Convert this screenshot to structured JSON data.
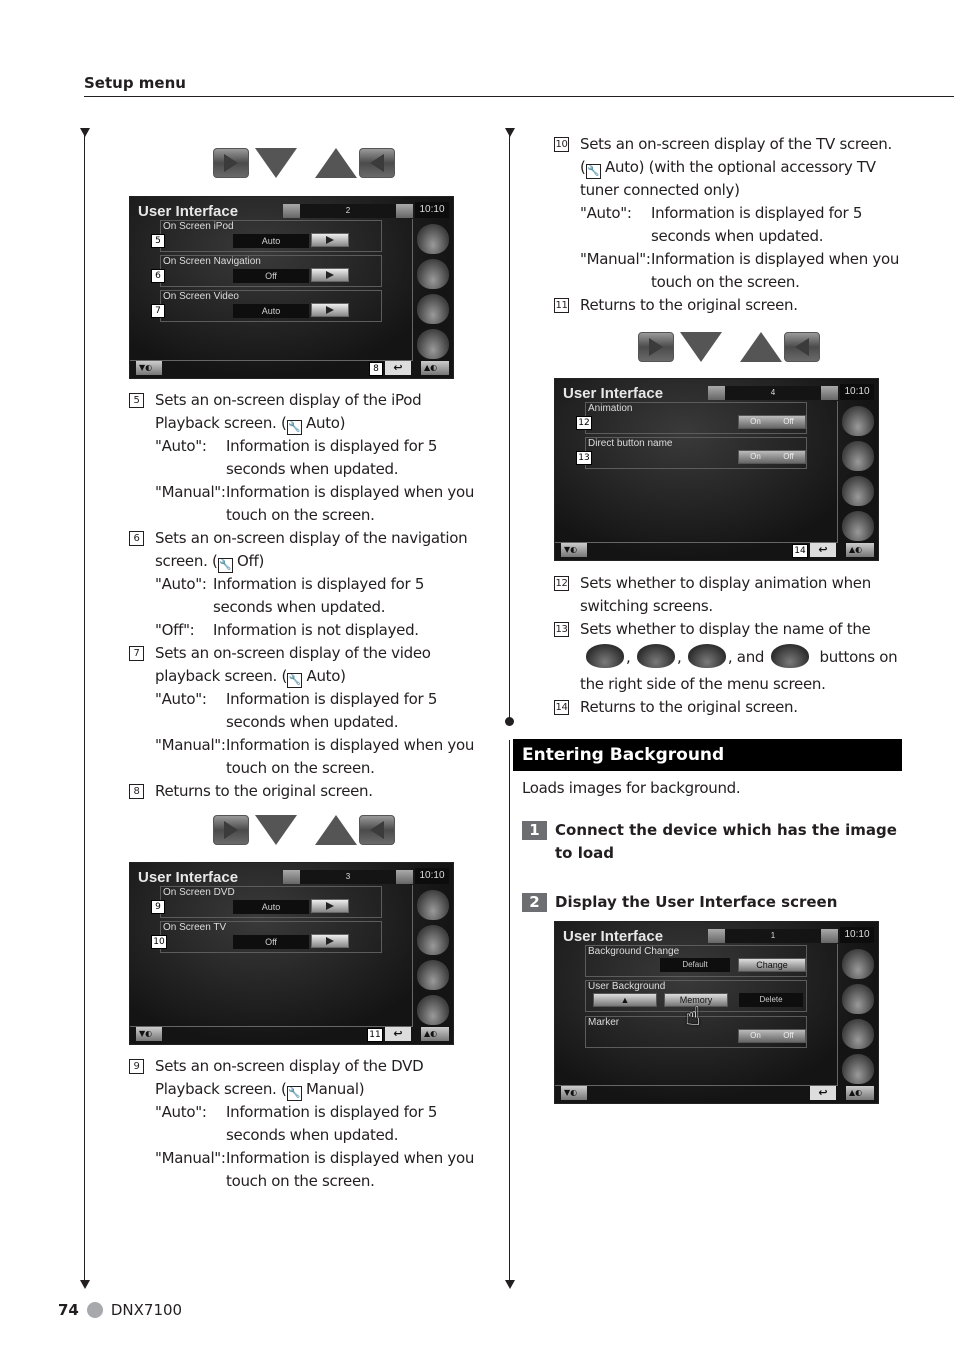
{
  "header": {
    "section": "Setup menu"
  },
  "screens": [
    {
      "title": "User Interface",
      "page": "2",
      "clock": "10:10",
      "rows": [
        {
          "label": "On Screen iPod",
          "value": "Auto",
          "callout": "5"
        },
        {
          "label": "On Screen Navigation",
          "value": "Off",
          "callout": "6"
        },
        {
          "label": "On Screen Video",
          "value": "Auto",
          "callout": "7"
        }
      ],
      "return_callout": "8"
    },
    {
      "title": "User Interface",
      "page": "3",
      "clock": "10:10",
      "rows": [
        {
          "label": "On Screen DVD",
          "value": "Auto",
          "callout": "9"
        },
        {
          "label": "On Screen TV",
          "value": "Off",
          "callout": "10"
        }
      ],
      "return_callout": "11"
    },
    {
      "title": "User Interface",
      "page": "4",
      "clock": "10:10",
      "rows": [
        {
          "label": "Animation",
          "on": "On",
          "off": "Off",
          "callout": "12"
        },
        {
          "label": "Direct button name",
          "on": "On",
          "off": "Off",
          "callout": "13"
        }
      ],
      "return_callout": "14"
    },
    {
      "title": "User Interface",
      "page": "1",
      "clock": "10:10",
      "rows": [
        {
          "label": "Background Change",
          "value": "Default",
          "button": "Change"
        },
        {
          "label": "User Background",
          "eject": "▲",
          "button": "Memory",
          "delete": "Delete"
        },
        {
          "label": "Marker",
          "on": "On",
          "off": "Off"
        }
      ]
    }
  ],
  "left_items": [
    {
      "num": "5",
      "lines": [
        "Sets an on-screen display of the iPod",
        "Playback screen. ("
      ],
      "default": "Auto)",
      "options": [
        {
          "key": "\"Auto\":",
          "desc": [
            "Information is displayed for 5",
            "seconds when updated."
          ]
        },
        {
          "key": "\"Manual\":",
          "desc": [
            "Information is displayed when you",
            "touch on the screen."
          ]
        }
      ]
    },
    {
      "num": "6",
      "lines": [
        "Sets an on-screen display of the navigation",
        "screen. ("
      ],
      "default": "Off)",
      "options": [
        {
          "key": "\"Auto\":",
          "desc": [
            "Information is displayed for 5",
            "seconds when updated."
          ]
        },
        {
          "key": "\"Off\":",
          "desc": [
            "Information is not displayed."
          ]
        }
      ]
    },
    {
      "num": "7",
      "lines": [
        "Sets an on-screen display of the video",
        "playback screen. ("
      ],
      "default": "Auto)",
      "options": [
        {
          "key": "\"Auto\":",
          "desc": [
            "Information is displayed for 5",
            "seconds when updated."
          ]
        },
        {
          "key": "\"Manual\":",
          "desc": [
            "Information is displayed when you",
            "touch on the screen."
          ]
        }
      ]
    },
    {
      "num": "8",
      "text": "Returns to the original screen."
    },
    {
      "num": "9",
      "lines": [
        "Sets an on-screen display of the DVD",
        "Playback screen. ("
      ],
      "default": "Manual)",
      "options": [
        {
          "key": "\"Auto\":",
          "desc": [
            "Information is displayed for 5",
            "seconds when updated."
          ]
        },
        {
          "key": "\"Manual\":",
          "desc": [
            "Information is displayed when you",
            "touch on the screen."
          ]
        }
      ]
    }
  ],
  "right_items": {
    "item10": {
      "num": "10",
      "line1": "Sets an on-screen display of the TV screen.",
      "line2_default": "Auto) (with the optional accessory TV",
      "line3": "tuner connected only)",
      "options": [
        {
          "key": "\"Auto\":",
          "desc": [
            "Information is displayed for 5",
            "seconds when updated."
          ]
        },
        {
          "key": "\"Manual\":",
          "desc": [
            "Information is displayed when you",
            "touch on the screen."
          ]
        }
      ]
    },
    "item11": {
      "num": "11",
      "text": "Returns to the original screen."
    },
    "item12": {
      "num": "12",
      "lines": [
        "Sets whether to display animation when",
        "switching screens."
      ]
    },
    "item13": {
      "num": "13",
      "line1": "Sets whether to display the name of the",
      "sep1": ",",
      "sep2": ",",
      "sep3": ", and",
      "tail": "buttons on",
      "line3": "the right side of the menu screen."
    },
    "item14": {
      "num": "14",
      "text": "Returns to the original screen."
    }
  },
  "background_section": {
    "title": "Entering Background",
    "intro": "Loads images for background.",
    "steps": [
      {
        "num": "1",
        "text": "Connect the device which has the image to load"
      },
      {
        "num": "2",
        "text": "Display the User Interface screen"
      }
    ]
  },
  "footer": {
    "page_number": "74",
    "model": "DNX7100"
  }
}
